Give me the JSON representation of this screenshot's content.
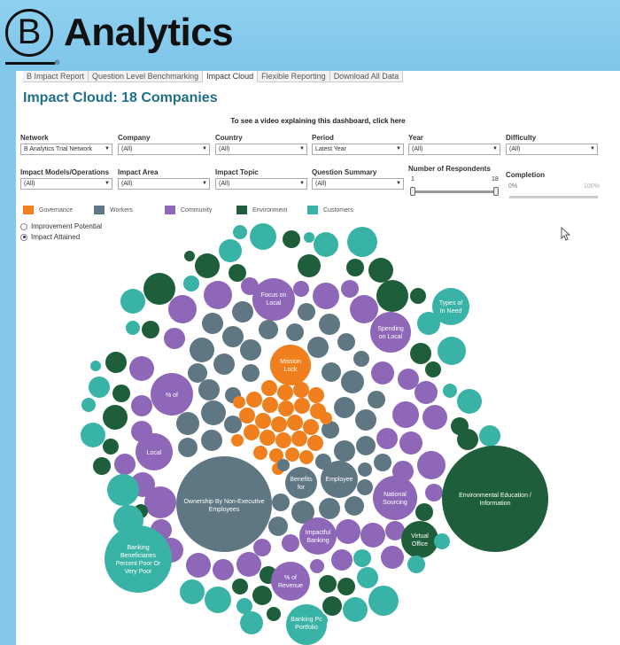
{
  "brand": {
    "logo_letter": "B",
    "title": "Analytics"
  },
  "tabs": [
    {
      "label": "B Impact Report",
      "active": false
    },
    {
      "label": "Question Level Benchmarking",
      "active": false
    },
    {
      "label": "Impact Cloud",
      "active": true
    },
    {
      "label": "Flexible Reporting",
      "active": false
    },
    {
      "label": "Download All Data",
      "active": false
    }
  ],
  "dashboard": {
    "title": "Impact Cloud: 18 Companies",
    "video_link": "To see a video explaining this dashboard, click here"
  },
  "filters": {
    "network": {
      "label": "Network",
      "value": "B Analytics Trial Network"
    },
    "company": {
      "label": "Company",
      "value": "(All)"
    },
    "country": {
      "label": "Country",
      "value": "(All)"
    },
    "period": {
      "label": "Period",
      "value": "Latest Year"
    },
    "year": {
      "label": "Year",
      "value": "(All)"
    },
    "difficulty": {
      "label": "Difficulty",
      "value": "(All)"
    },
    "impact_models": {
      "label": "Impact Models/Operations",
      "value": "(All)"
    },
    "impact_area": {
      "label": "Impact Area",
      "value": "(All)"
    },
    "impact_topic": {
      "label": "Impact Topic",
      "value": "(All)"
    },
    "question_summary": {
      "label": "Question Summary",
      "value": "(All)"
    }
  },
  "respondents": {
    "label": "Number of Respondents",
    "min": "1",
    "max": "18"
  },
  "completion": {
    "label": "Completion",
    "min": "0%",
    "max": "100%"
  },
  "legend": [
    {
      "label": "Governance",
      "color": "#f07f1e"
    },
    {
      "label": "Workers",
      "color": "#5f7782"
    },
    {
      "label": "Community",
      "color": "#8e67b8"
    },
    {
      "label": "Environment",
      "color": "#1e5e3a"
    },
    {
      "label": "Customers",
      "color": "#3ab3a7"
    }
  ],
  "view_options": [
    {
      "label": "Improvement Potential",
      "selected": false
    },
    {
      "label": "Impact Attained",
      "selected": true
    }
  ],
  "bubble_labels": {
    "focus_local": [
      "Focus on",
      "Local"
    ],
    "types_need": [
      "Types of",
      "In Need"
    ],
    "spending_local": [
      "Spending",
      "on Local"
    ],
    "mission_lock": [
      "Mission",
      "Lock"
    ],
    "pct_of": [
      "% of"
    ],
    "local": [
      "Local"
    ],
    "ownership": [
      "Ownership By Non-Executive",
      "Employees"
    ],
    "benefits_for": [
      "Benefits",
      "for"
    ],
    "employee": [
      "Employee"
    ],
    "national_sourcing": [
      "National",
      "Sourcing"
    ],
    "env_education": [
      "Environmental Education /",
      "Information"
    ],
    "impactful_banking": [
      "Impactful",
      "Banking"
    ],
    "virtual_office": [
      "Virtual",
      "Office"
    ],
    "banking_beneficiaries": [
      "Banking",
      "Beneficiaries",
      "Percent Poor Or",
      "Very Poor"
    ],
    "pct_revenue": [
      "% of",
      "Revenue"
    ],
    "banking_portfolio": [
      "Banking Pc",
      "Portfolio"
    ]
  }
}
